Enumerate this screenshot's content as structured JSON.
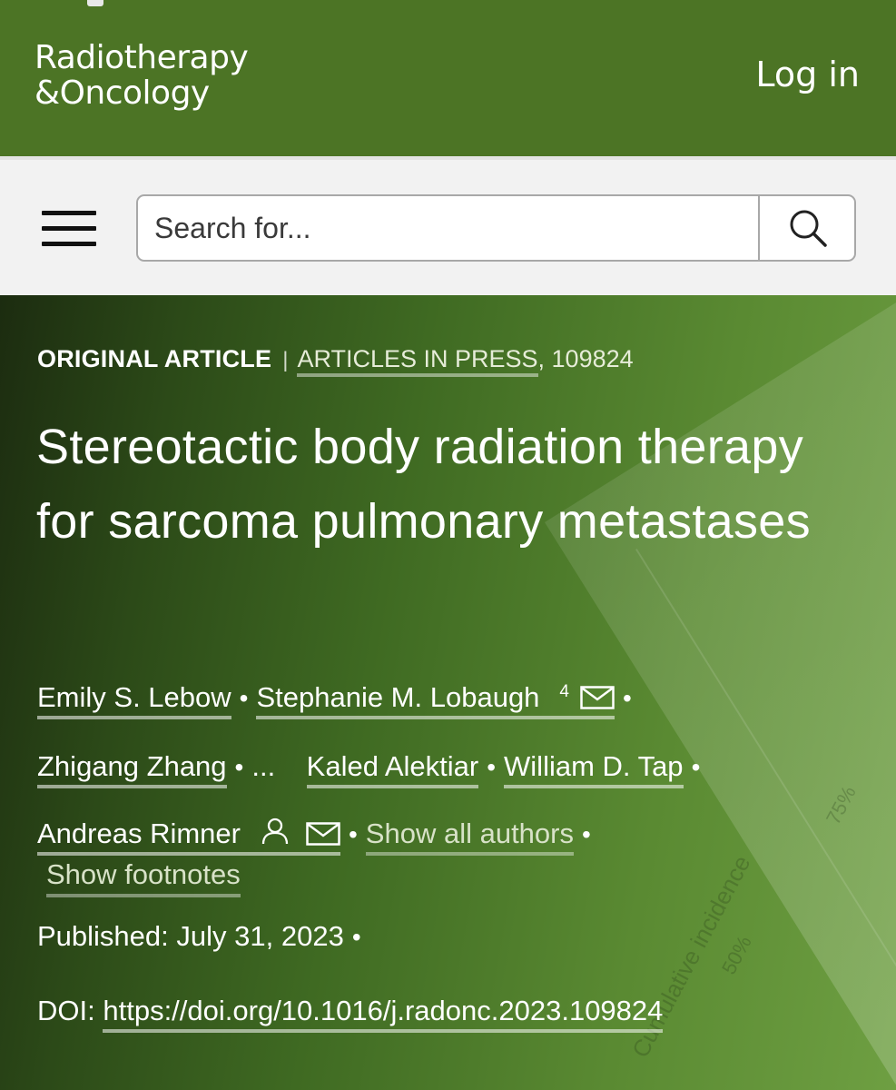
{
  "header": {
    "journal_line1": "Radiotherapy",
    "journal_line2": "&Oncology",
    "login_label": "Log in"
  },
  "search": {
    "placeholder": "Search for..."
  },
  "article": {
    "type": "ORIGINAL ARTICLE",
    "separator": "|",
    "section": "ARTICLES IN PRESS",
    "number": ", 109824",
    "title": "Stereotactic body radiation therapy for sarcoma pulmonary metastases",
    "authors": [
      "Emily S. Lebow",
      "Stephanie M. Lobaugh",
      "Zhigang Zhang",
      "Kaled Alektiar",
      "William D. Tap",
      "Andreas Rimner"
    ],
    "footnote_marker": "4",
    "ellipsis": "...",
    "show_all_authors": "Show all authors",
    "show_footnotes": "Show footnotes",
    "published_label": "Published:",
    "published_date": "July 31, 2023",
    "doi_label": "DOI:",
    "doi_url": "https://doi.org/10.1016/j.radonc.2023.109824"
  },
  "background_text": {
    "text1": "Cumulative incidence",
    "text2": "50%",
    "text3": "75%"
  },
  "colors": {
    "header_green": "#4c7425",
    "hero_dark": "#1c2c10",
    "hero_light": "#6e9f42"
  }
}
